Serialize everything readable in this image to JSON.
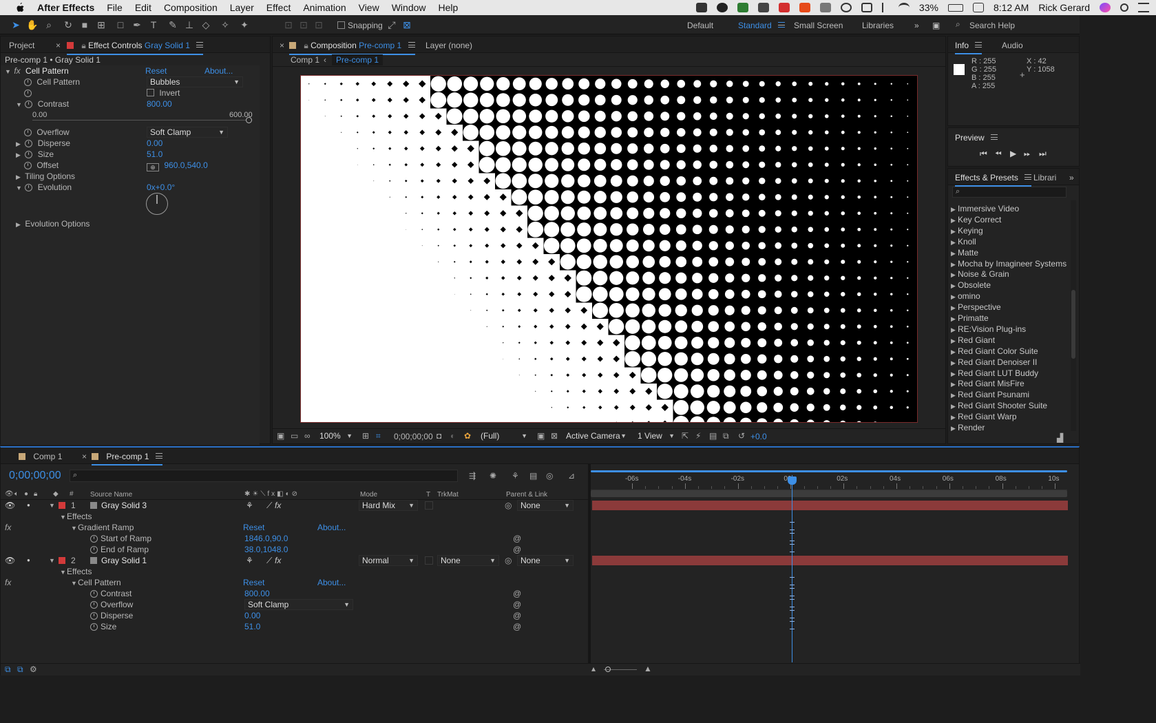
{
  "menubar": {
    "app_name": "After Effects",
    "items": [
      "File",
      "Edit",
      "Composition",
      "Layer",
      "Effect",
      "Animation",
      "View",
      "Window",
      "Help"
    ],
    "battery": "33%",
    "time": "8:12 AM",
    "user": "Rick Gerard"
  },
  "toolbar": {
    "snapping_label": "Snapping",
    "workspaces": [
      "Default",
      "Standard",
      "Small Screen",
      "Libraries"
    ],
    "active_workspace": "Standard",
    "search_placeholder": "Search Help"
  },
  "effect_controls": {
    "tab_project": "Project",
    "tab_label": "Effect Controls",
    "tab_layer": "Gray Solid 1",
    "breadcrumb": "Pre-comp 1 • Gray Solid 1",
    "effect_name": "Cell Pattern",
    "reset": "Reset",
    "about": "About...",
    "cell_pattern_label": "Cell Pattern",
    "cell_pattern_value": "Bubbles",
    "invert_label": "Invert",
    "contrast_label": "Contrast",
    "contrast_value": "800.00",
    "slider_min": "0.00",
    "slider_max": "600.00",
    "overflow_label": "Overflow",
    "overflow_value": "Soft Clamp",
    "disperse_label": "Disperse",
    "disperse_value": "0.00",
    "size_label": "Size",
    "size_value": "51.0",
    "offset_label": "Offset",
    "offset_value": "960.0,540.0",
    "tiling_label": "Tiling Options",
    "evolution_label": "Evolution",
    "evolution_value": "0x+0.0°",
    "evolution_options_label": "Evolution Options"
  },
  "viewer": {
    "tab_label": "Composition",
    "tab_comp": "Pre-comp 1",
    "layer_tab": "Layer (none)",
    "crumb_comp1": "Comp 1",
    "crumb_precomp": "Pre-comp 1",
    "zoom": "100%",
    "timecode": "0;00;00;00",
    "resolution": "(Full)",
    "camera": "Active Camera",
    "views": "1 View",
    "exposure": "+0.0"
  },
  "info": {
    "tab_info": "Info",
    "tab_audio": "Audio",
    "r": "R : 255",
    "g": "G : 255",
    "b": "B : 255",
    "a": "A : 255",
    "x": "X : 42",
    "y": "Y : 1058"
  },
  "preview": {
    "label": "Preview"
  },
  "effects_presets": {
    "tab_label": "Effects & Presets",
    "tab_libraries": "Librari",
    "items": [
      "Immersive Video",
      "Key Correct",
      "Keying",
      "Knoll",
      "Matte",
      "Mocha by Imagineer Systems",
      "Noise & Grain",
      "Obsolete",
      "omino",
      "Perspective",
      "Primatte",
      "RE:Vision Plug-ins",
      "Red Giant",
      "Red Giant Color Suite",
      "Red Giant Denoiser II",
      "Red Giant LUT Buddy",
      "Red Giant MisFire",
      "Red Giant Psunami",
      "Red Giant Shooter Suite",
      "Red Giant Warp",
      "Render"
    ]
  },
  "timeline": {
    "tab_comp1": "Comp 1",
    "tab_precomp": "Pre-comp 1",
    "timecode": "0;00;00;00",
    "col_source": "Source Name",
    "col_mode": "Mode",
    "col_t": "T",
    "col_trkmat": "TrkMat",
    "col_parent": "Parent & Link",
    "ruler": [
      "-06s",
      "-04s",
      "-02s",
      "00s",
      "02s",
      "04s",
      "06s",
      "08s",
      "10s"
    ],
    "layer1": {
      "num": "1",
      "name": "Gray Solid 3",
      "mode": "Hard Mix",
      "parent": "None",
      "effects_label": "Effects",
      "effect": "Gradient Ramp",
      "reset": "Reset",
      "about": "About...",
      "start_label": "Start of Ramp",
      "start_value": "1846.0,90.0",
      "end_label": "End of Ramp",
      "end_value": "38.0,1048.0"
    },
    "layer2": {
      "num": "2",
      "name": "Gray Solid 1",
      "mode": "Normal",
      "trkmat": "None",
      "parent": "None",
      "effects_label": "Effects",
      "effect": "Cell Pattern",
      "reset": "Reset",
      "about": "About...",
      "contrast_label": "Contrast",
      "contrast_value": "800.00",
      "overflow_label": "Overflow",
      "overflow_value": "Soft Clamp",
      "disperse_label": "Disperse",
      "disperse_value": "0.00",
      "size_label": "Size",
      "size_value": "51.0"
    }
  },
  "colors": {
    "accent": "#3d8fe6",
    "layer_bar": "#8b3a3a",
    "label_red": "#d33a3a",
    "panel_bg": "#232323"
  }
}
